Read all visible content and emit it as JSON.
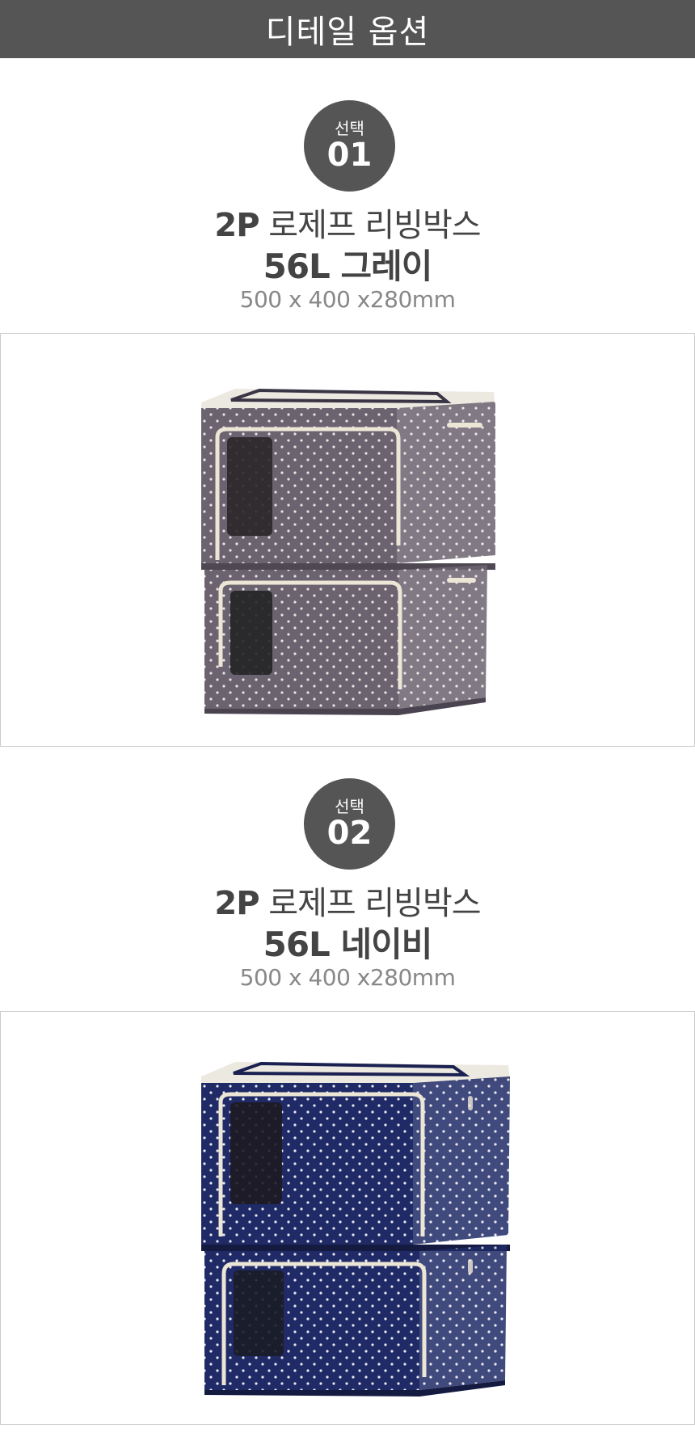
{
  "header": {
    "title": "디테일 옵션"
  },
  "options": [
    {
      "badge_prefix": "선택",
      "badge_number": "01",
      "name_bold": "2P",
      "name_rest": "로제프 리빙박스",
      "capacity_color": "56L 그레이",
      "dimensions": "500 x 400 x280mm",
      "fabric_color": "#6b6370",
      "image_label": "gray-polka-dot-storage-box"
    },
    {
      "badge_prefix": "선택",
      "badge_number": "02",
      "name_bold": "2P",
      "name_rest": "로제프 리빙박스",
      "capacity_color": "56L 네이비",
      "dimensions": "500 x 400 x280mm",
      "fabric_color": "#1f2a66",
      "image_label": "navy-polka-dot-storage-box"
    }
  ],
  "colors": {
    "header_bg": "#555555",
    "badge_bg": "#555555",
    "text": "#444444",
    "zipper": "#ece6d6"
  }
}
